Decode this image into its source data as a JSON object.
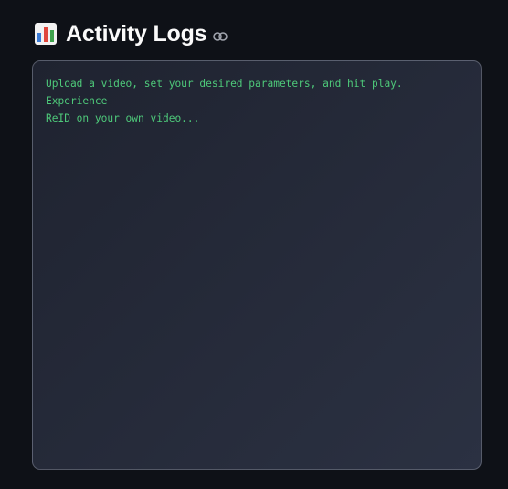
{
  "header": {
    "icon": "bar-chart-icon",
    "title": "Activity Logs",
    "anchor_icon": "link-icon"
  },
  "logs": {
    "text": "Upload a video, set your desired parameters, and hit play. Experience\nReID on your own video..."
  },
  "colors": {
    "background": "#0e1117",
    "log_text": "#4ec97a",
    "title": "#fafafa"
  }
}
